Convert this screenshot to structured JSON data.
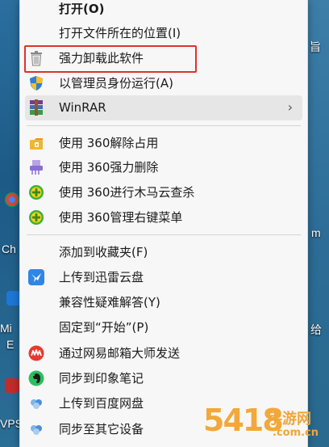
{
  "menu": {
    "items": [
      {
        "key": "open",
        "label": "打开(O)",
        "icon": "none"
      },
      {
        "key": "open_location",
        "label": "打开文件所在的位置(I)",
        "icon": "none"
      },
      {
        "key": "force_uninstall",
        "label": "强力卸载此软件",
        "icon": "trash-icon"
      },
      {
        "key": "run_as_admin",
        "label": "以管理员身份运行(A)",
        "icon": "uac-shield-icon"
      },
      {
        "key": "winrar",
        "label": "WinRAR",
        "icon": "winrar-icon",
        "submenu": "›"
      },
      {
        "key": "unlock_360",
        "label": "使用 360解除占用",
        "icon": "360-unlock-icon"
      },
      {
        "key": "shred_360",
        "label": "使用 360强力删除",
        "icon": "360-shred-icon"
      },
      {
        "key": "trojan_scan_360",
        "label": "使用 360进行木马云查杀",
        "icon": "360-scan-icon"
      },
      {
        "key": "rightclick_mgr_360",
        "label": "使用 360管理右键菜单",
        "icon": "360-menu-icon"
      },
      {
        "key": "add_favorites",
        "label": "添加到收藏夹(F)",
        "icon": "none"
      },
      {
        "key": "xunlei_upload",
        "label": "上传到迅雷云盘",
        "icon": "xunlei-icon"
      },
      {
        "key": "compat_troubleshoot",
        "label": "兼容性疑难解答(Y)",
        "icon": "none"
      },
      {
        "key": "pin_start",
        "label": "固定到“开始”(P)",
        "icon": "none"
      },
      {
        "key": "netease_mail",
        "label": "通过网易邮箱大师发送",
        "icon": "netease-mail-icon"
      },
      {
        "key": "evernote",
        "label": "同步到印象笔记",
        "icon": "evernote-icon"
      },
      {
        "key": "baidu_upload",
        "label": "上传到百度网盘",
        "icon": "baidu-pan-icon"
      },
      {
        "key": "sync_devices",
        "label": "同步至其它设备",
        "icon": "baidu-sync-icon"
      }
    ]
  },
  "desktop": {
    "labels": [
      "Ch",
      "Mi",
      "E",
      "VPS",
      "旨",
      "m",
      "给"
    ]
  },
  "watermark": {
    "number": "5418",
    "site": "手游网",
    "domain": ".com.cn"
  },
  "colors": {
    "highlight": "#e0312b",
    "menu_bg": "#f7f7f7",
    "hover_bg": "#e6e6e6"
  }
}
